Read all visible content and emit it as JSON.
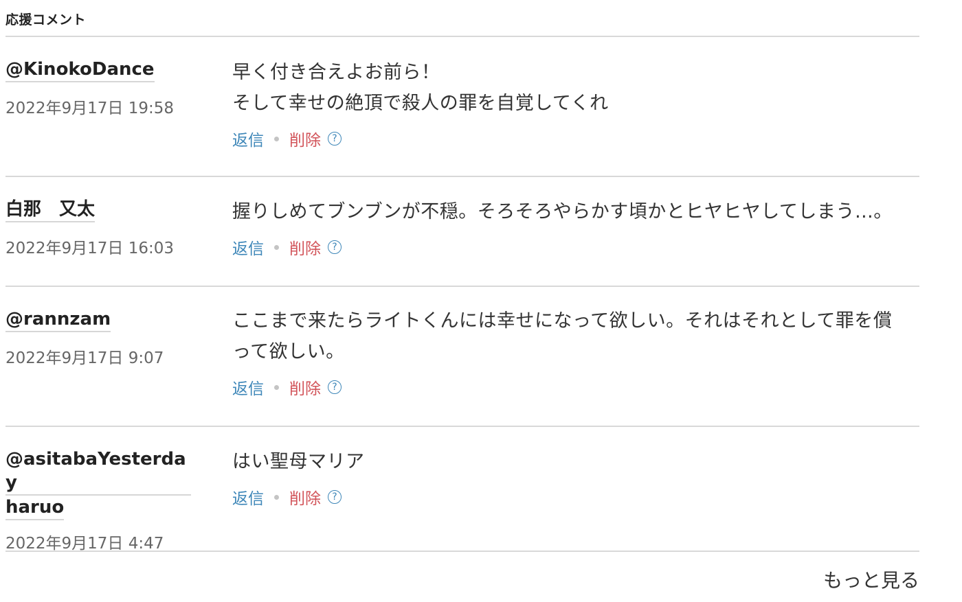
{
  "section": {
    "title": "応援コメント"
  },
  "comments": [
    {
      "author": "@KinokoDance",
      "date": "2022年9月17日 19:58",
      "text": "早く付き合えよお前ら！\nそして幸せの絶頂で殺人の罪を自覚してくれ",
      "reply_label": "返信",
      "delete_label": "削除",
      "help_icon": "?"
    },
    {
      "author": "白那　又太",
      "date": "2022年9月17日 16:03",
      "text": "握りしめてブンブンが不穏。そろそろやらかす頃かとヒヤヒヤしてしまう…。",
      "reply_label": "返信",
      "delete_label": "削除",
      "help_icon": "?"
    },
    {
      "author": "@rannzam",
      "date": "2022年9月17日 9:07",
      "text": "ここまで来たらライトくんには幸せになって欲しい。それはそれとして罪を償\nって欲しい。",
      "reply_label": "返信",
      "delete_label": "削除",
      "help_icon": "?"
    },
    {
      "author_line1": "@asitabaYesterday",
      "author_line2": "haruo",
      "date": "2022年9月17日 4:47",
      "text": "はい聖母マリア",
      "reply_label": "返信",
      "delete_label": "削除",
      "help_icon": "?"
    }
  ],
  "more_label": "もっと見る",
  "colors": {
    "reply": "#3d86b8",
    "delete": "#d2545a",
    "divider": "#d8d8d8"
  }
}
